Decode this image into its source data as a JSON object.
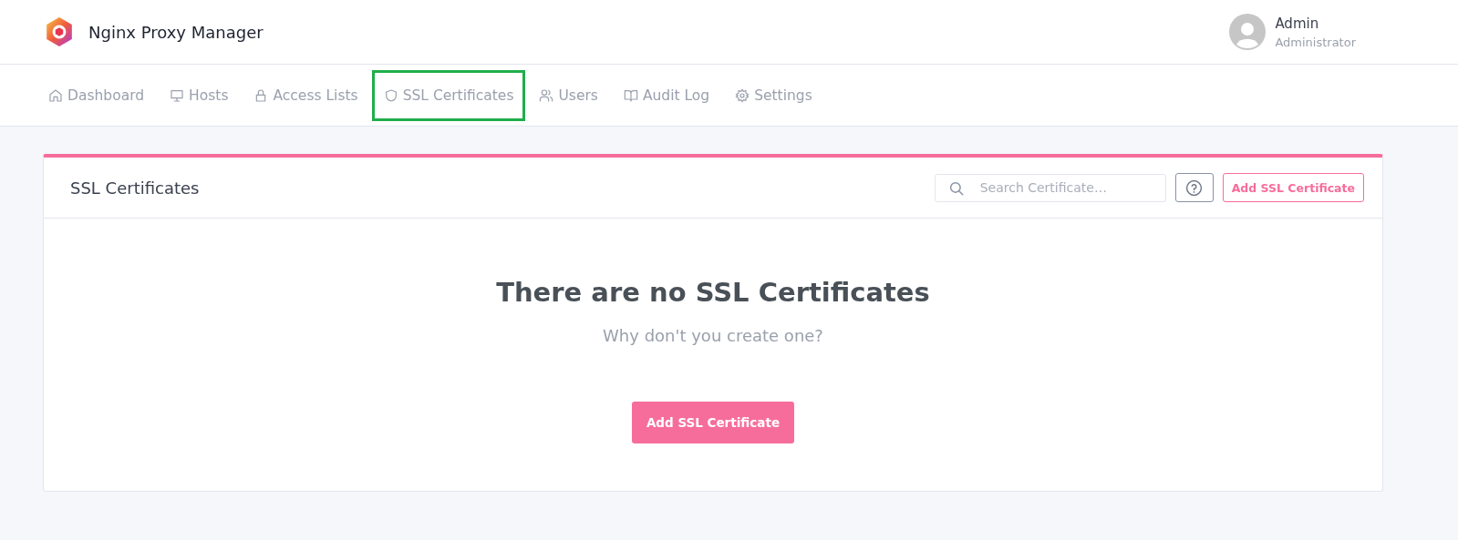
{
  "app": {
    "title": "Nginx Proxy Manager"
  },
  "user": {
    "name": "Admin",
    "role": "Administrator"
  },
  "nav": [
    {
      "label": "Dashboard",
      "highlighted": false
    },
    {
      "label": "Hosts",
      "highlighted": false
    },
    {
      "label": "Access Lists",
      "highlighted": false
    },
    {
      "label": "SSL Certificates",
      "highlighted": true
    },
    {
      "label": "Users",
      "highlighted": false
    },
    {
      "label": "Audit Log",
      "highlighted": false
    },
    {
      "label": "Settings",
      "highlighted": false
    }
  ],
  "card": {
    "title": "SSL Certificates",
    "search": {
      "placeholder": "Search Certificate…"
    },
    "add_button": "Add SSL Certificate",
    "empty": {
      "heading": "There are no SSL Certificates",
      "text": "Why don't you create one?",
      "button": "Add SSL Certificate"
    }
  }
}
